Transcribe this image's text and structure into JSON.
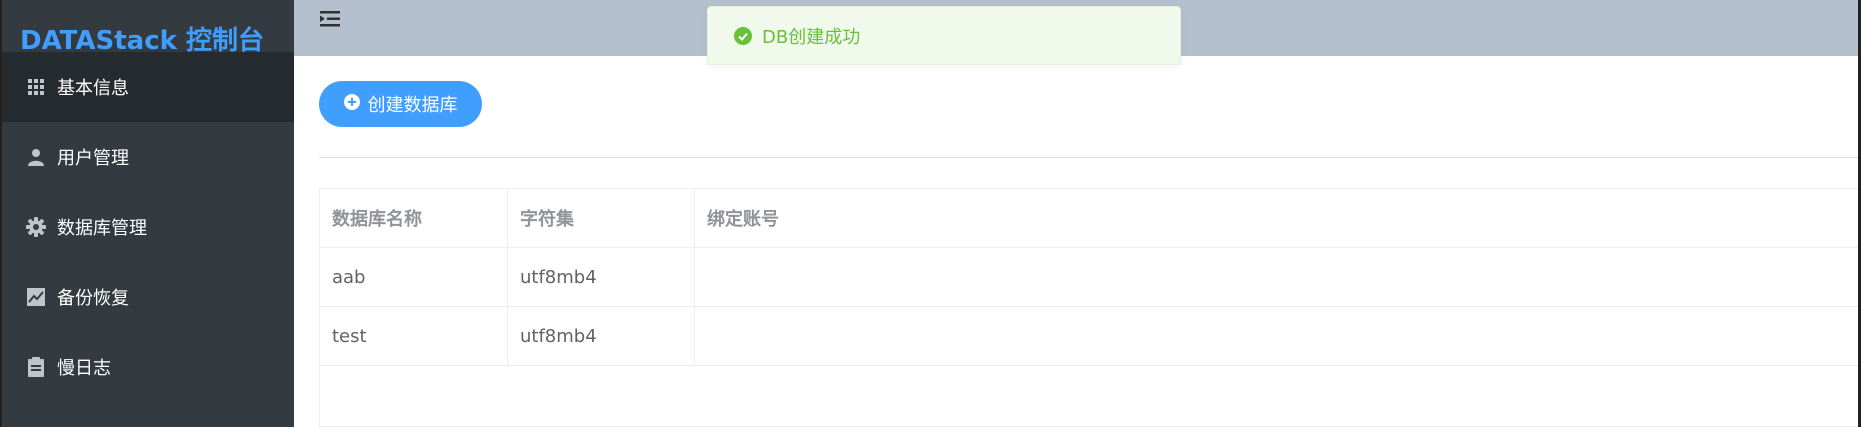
{
  "brand": {
    "title": "DATAStack 控制台"
  },
  "sidebar": {
    "items": [
      {
        "label": "基本信息",
        "icon": "grid-icon"
      },
      {
        "label": "用户管理",
        "icon": "user-icon"
      },
      {
        "label": "数据库管理",
        "icon": "gear-icon"
      },
      {
        "label": "备份恢复",
        "icon": "chart-icon"
      },
      {
        "label": "慢日志",
        "icon": "clipboard-icon"
      }
    ]
  },
  "toolbar": {
    "create_label": "创建数据库"
  },
  "table": {
    "headers": [
      "数据库名称",
      "字符集",
      "绑定账号"
    ],
    "rows": [
      [
        "aab",
        "utf8mb4",
        ""
      ],
      [
        "test",
        "utf8mb4",
        ""
      ]
    ]
  },
  "toast": {
    "message": "DB创建成功"
  },
  "colors": {
    "accent": "#409eff",
    "sidebar": "#333a40",
    "header": "#b4bfce",
    "success": "#67c23a"
  }
}
